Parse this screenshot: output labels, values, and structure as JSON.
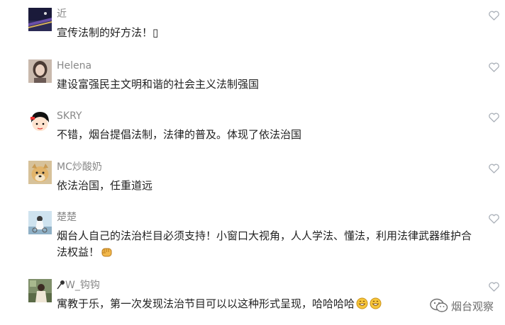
{
  "comments": [
    {
      "name": "近",
      "text": "宣传法制的好方法！▯"
    },
    {
      "name": "Helena",
      "text": "建设富强民主文明和谐的社会主义法制强国"
    },
    {
      "name": "SKRY",
      "text": "不错，烟台提倡法制，法律的普及。体现了依法治国"
    },
    {
      "name": "MC炒酸奶",
      "text": "依法治国，任重道远"
    },
    {
      "name": "楚楚",
      "text": "烟台人自己的法治栏目必须支持！小窗口大视角，人人学法、懂法，利用法律武器维护合法权益！"
    },
    {
      "name": "W_钩钩",
      "text": "寓教于乐，第一次发现法治节目可以以这种形式呈现，哈哈哈哈"
    }
  ],
  "watermark": {
    "label": "烟台观察"
  },
  "icons": {
    "like": "heart-outline-icon",
    "fist": "fist-emoji-icon",
    "grin": "grinning-emoji-icon",
    "pin": "pin-icon",
    "watermark": "wechat-logo-icon"
  },
  "colors": {
    "name": "#888888",
    "text": "#222222",
    "heart": "#aab0b8"
  }
}
